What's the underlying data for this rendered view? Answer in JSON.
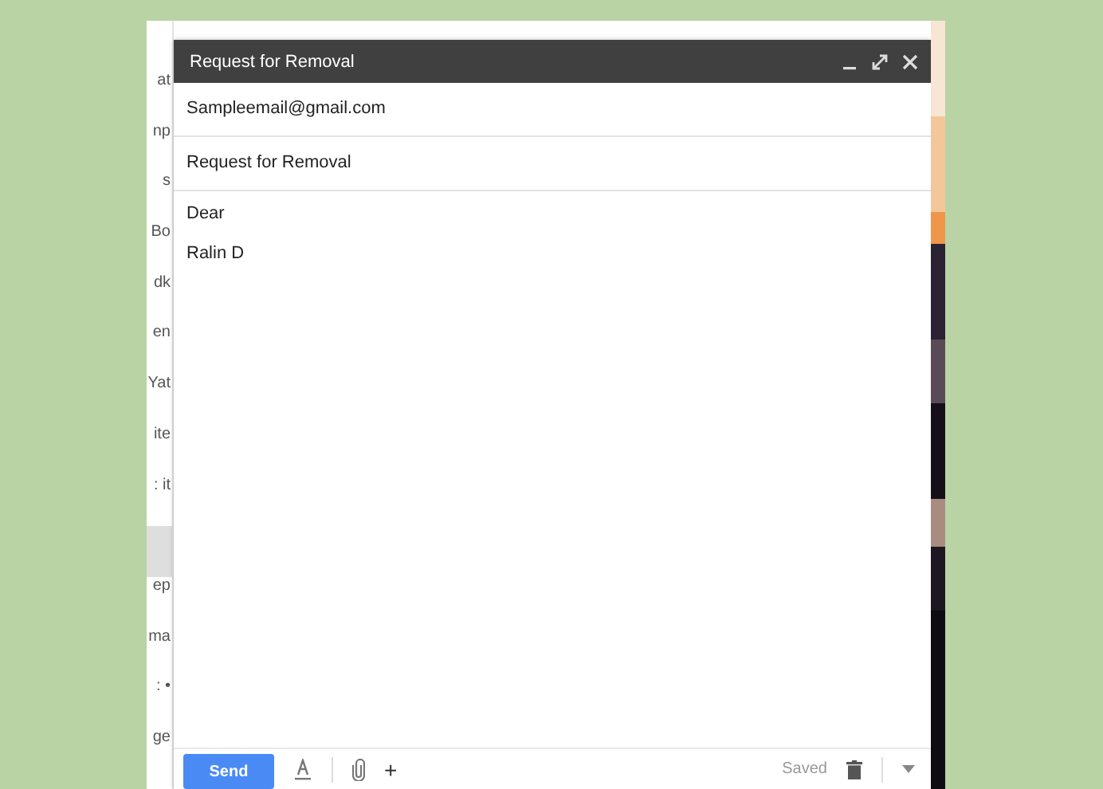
{
  "background_list": [
    {
      "text": "at",
      "selected": false
    },
    {
      "text": "np",
      "selected": false
    },
    {
      "text": "s",
      "selected": false
    },
    {
      "text": "Bo",
      "selected": false
    },
    {
      "text": "dk",
      "selected": false
    },
    {
      "text": "en",
      "selected": false
    },
    {
      "text": "Yat",
      "selected": false
    },
    {
      "text": "ite",
      "selected": false
    },
    {
      "text": ": it",
      "selected": false
    },
    {
      "selected": true
    },
    {
      "text": "ep",
      "selected": false
    },
    {
      "text": "ma",
      "selected": false
    },
    {
      "text": ": •",
      "selected": false
    },
    {
      "text": "ge",
      "selected": false
    }
  ],
  "compose": {
    "title": "Request for Removal",
    "to": "Sampleemail@gmail.com",
    "subject": "Request for Removal",
    "body": [
      "Dear",
      "Ralin D"
    ],
    "toolbar": {
      "send": "Send",
      "plus": "+",
      "status": "Saved"
    }
  }
}
